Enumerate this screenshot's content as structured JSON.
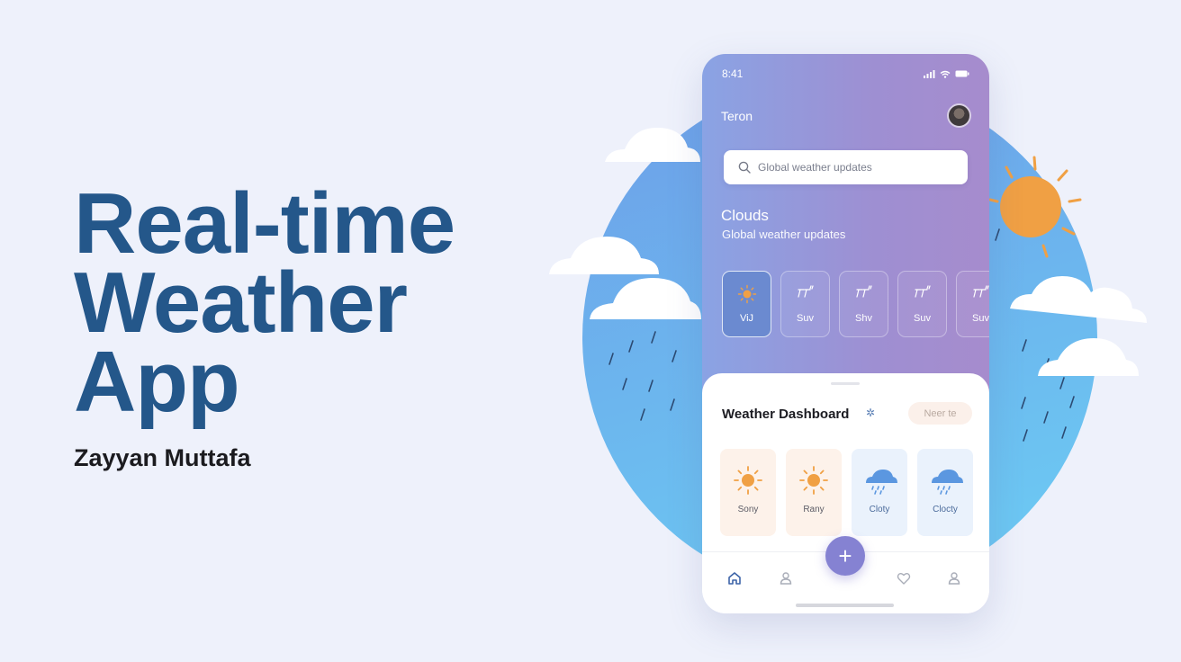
{
  "hero": {
    "title_lines": [
      "Real-time",
      "Weather",
      "App"
    ],
    "author": "Zayyan Muttafa"
  },
  "phone": {
    "status": {
      "time": "8:41"
    },
    "city": "Teron",
    "search": {
      "placeholder": "Global weather updates"
    },
    "conditions": {
      "title": "Clouds",
      "subtitle": "Global weather updates"
    },
    "days": [
      {
        "label": "ViJ",
        "icon": "sun-icon",
        "active": true
      },
      {
        "label": "Suv",
        "icon": "rain-glyph-icon"
      },
      {
        "label": "Shv",
        "icon": "rain-glyph-icon"
      },
      {
        "label": "Suv",
        "icon": "rain-glyph-icon"
      },
      {
        "label": "Suv",
        "icon": "rain-glyph-icon"
      }
    ],
    "dashboard": {
      "title": "Weather Dashboard",
      "chip": "Neer te",
      "cards": [
        {
          "label": "Sony",
          "icon": "sun-icon",
          "tone": "warm"
        },
        {
          "label": "Rany",
          "icon": "sun-icon",
          "tone": "warm"
        },
        {
          "label": "Cloty",
          "icon": "rain-cloud-icon",
          "tone": "cool"
        },
        {
          "label": "Clocty",
          "icon": "rain-cloud-icon",
          "tone": "cool"
        }
      ]
    },
    "nav": {
      "fab": "+",
      "items": [
        "home-icon",
        "profile-icon",
        "heart-icon",
        "user-icon"
      ]
    }
  },
  "colors": {
    "title": "#24578a",
    "globe": "#6fa8ec",
    "sun": "#f0a044",
    "phone_gradient_start": "#8aa3e4",
    "phone_gradient_end": "#a68ccd",
    "fab": "#8582d2"
  }
}
